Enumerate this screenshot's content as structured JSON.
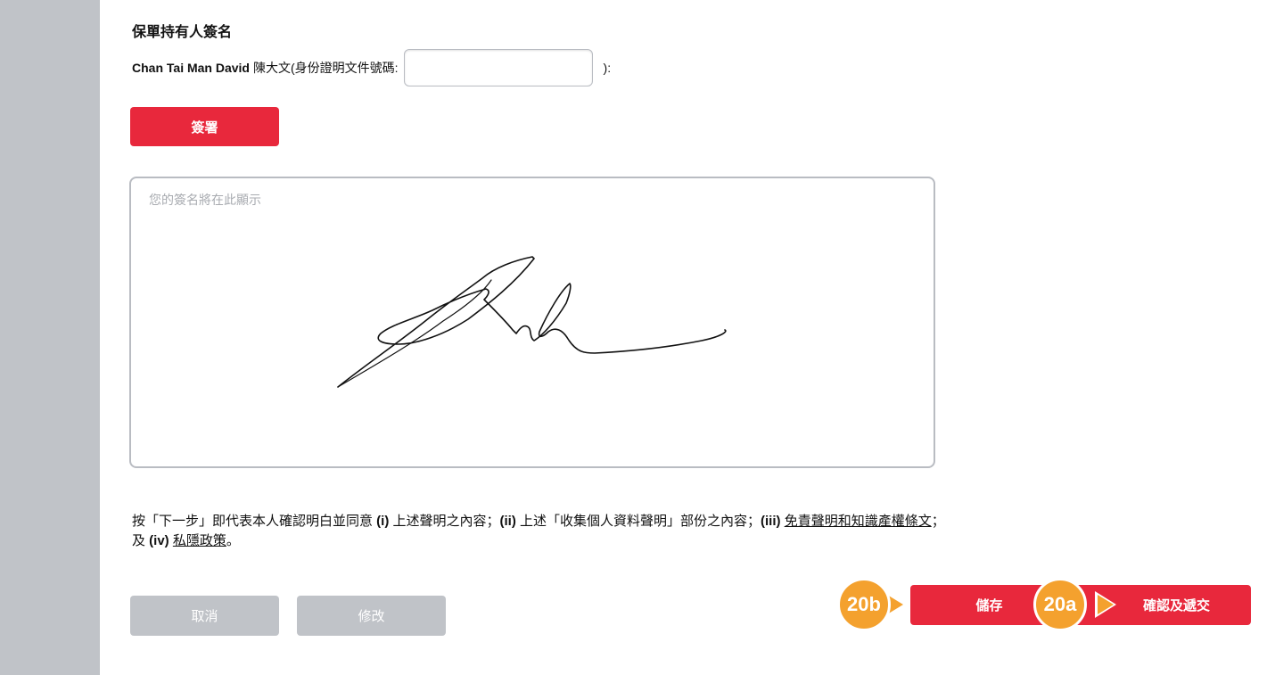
{
  "section_title": "保單持有人簽名",
  "identity": {
    "name": "Chan Tai Man David",
    "name_cn": "陳大文",
    "id_label": "(身份證明文件號碼:",
    "id_value": "",
    "id_suffix": "):"
  },
  "sign_button_label": "簽署",
  "signature_box": {
    "placeholder": "您的簽名將在此顯示"
  },
  "disclaimer": {
    "p1": "按「下一步」即代表本人確認明白並同意 ",
    "i1": "(i)",
    "p2": " 上述聲明之內容；",
    "i2": "(ii)",
    "p3": " 上述「收集個人資料聲明」部份之內容；",
    "i3": "(iii)",
    "link1": "免責聲明和知識產權條文",
    "p4": "；",
    "p5": "及 ",
    "i4": "(iv)",
    "link2": "私隱政策",
    "p6": "。"
  },
  "buttons": {
    "cancel": "取消",
    "modify": "修改",
    "save": "儲存",
    "confirm": "確認及遞交"
  },
  "callouts": {
    "save": "20b",
    "confirm": "20a"
  },
  "colors": {
    "primary_red": "#e8283c",
    "disabled_grey": "#c0c3c8",
    "callout_orange": "#f4a12e",
    "sidebar_grey": "#c0c3c8"
  }
}
